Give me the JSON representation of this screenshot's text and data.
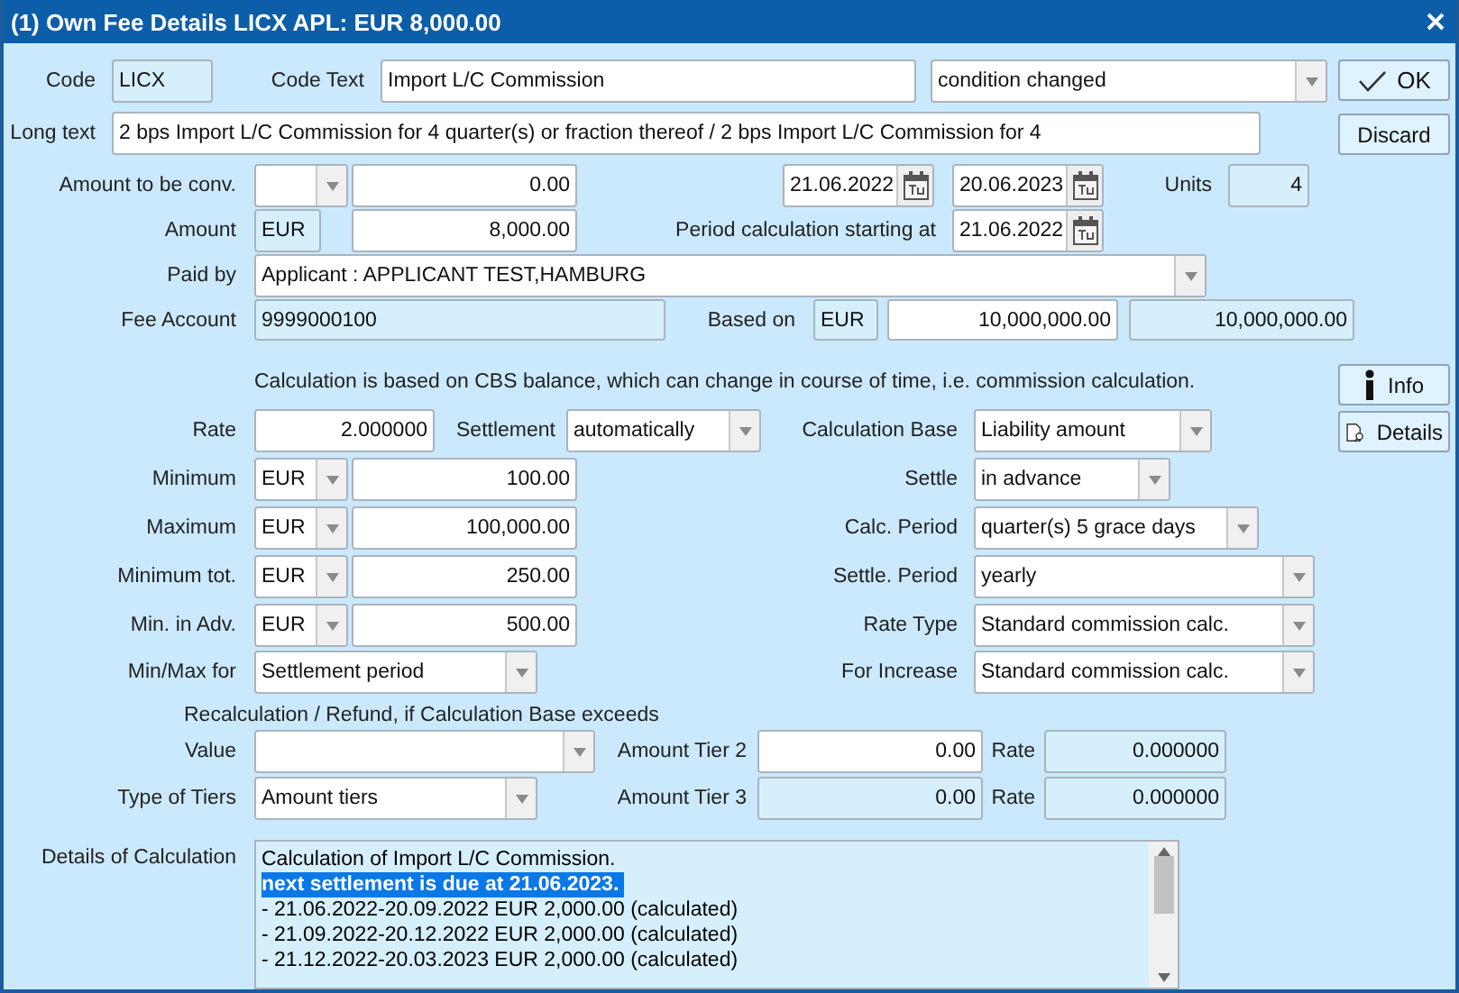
{
  "window": {
    "title": "(1) Own Fee Details LICX APL: EUR 8,000.00"
  },
  "rows": [
    {
      "fields": [
        {
          "kind": "label",
          "text": "Code"
        },
        {
          "kind": "readonly",
          "value": "LICX"
        },
        {
          "kind": "label",
          "text": "Code Text"
        },
        {
          "kind": "text",
          "value": "Import L/C Commission"
        },
        {
          "kind": "combo",
          "value": "condition changed"
        }
      ]
    },
    {
      "fields": [
        {
          "kind": "label",
          "text": "Long text"
        },
        {
          "kind": "text",
          "value": "2 bps Import L/C Commission for 4 quarter(s) or fraction thereof / 2 bps Import L/C Commission for 4"
        }
      ]
    },
    {
      "fields": [
        {
          "kind": "label",
          "text": "Amount to be conv."
        },
        {
          "kind": "combo"
        },
        {
          "kind": "number",
          "value": "0.00"
        },
        {
          "kind": "date",
          "value": "21.06.2022"
        },
        {
          "kind": "date",
          "value": "20.06.2023"
        },
        {
          "kind": "label",
          "text": "Units"
        },
        {
          "kind": "readonly_number",
          "value": "4"
        }
      ]
    },
    {
      "fields": [
        {
          "kind": "label",
          "text": "Amount"
        },
        {
          "kind": "readonly",
          "value": "EUR"
        },
        {
          "kind": "number",
          "value": "8,000.00"
        },
        {
          "kind": "label",
          "text": "Period calculation starting at"
        },
        {
          "kind": "date",
          "value": "21.06.2022"
        }
      ]
    },
    {
      "fields": [
        {
          "kind": "label",
          "text": "Paid by"
        },
        {
          "kind": "combo",
          "value": "Applicant : APPLICANT TEST,HAMBURG"
        }
      ]
    },
    {
      "fields": [
        {
          "kind": "label",
          "text": "Fee Account"
        },
        {
          "kind": "readonly",
          "value": "9999000100"
        },
        {
          "kind": "label",
          "text": "Based on"
        },
        {
          "kind": "readonly",
          "value": "EUR"
        },
        {
          "kind": "number",
          "value": "10,000,000.00"
        },
        {
          "kind": "readonly_number",
          "value": "10,000,000.00"
        }
      ]
    },
    {
      "fields": [
        {
          "kind": "note",
          "text": "Calculation is based on CBS balance, which can change in course of time, i.e. commission calculation."
        }
      ]
    },
    {
      "fields": [
        {
          "kind": "label",
          "text": "Rate"
        },
        {
          "kind": "number",
          "value": "2.000000"
        },
        {
          "kind": "label",
          "text": "Settlement"
        },
        {
          "kind": "combo",
          "value": "automatically"
        },
        {
          "kind": "label",
          "text": "Calculation Base"
        },
        {
          "kind": "combo",
          "value": "Liability amount"
        }
      ]
    },
    {
      "fields": [
        {
          "kind": "label",
          "text": "Minimum"
        },
        {
          "kind": "combo",
          "value": "EUR"
        },
        {
          "kind": "number",
          "value": "100.00"
        },
        {
          "kind": "label",
          "text": "Settle"
        },
        {
          "kind": "combo",
          "value": "in advance"
        }
      ]
    },
    {
      "fields": [
        {
          "kind": "label",
          "text": "Maximum"
        },
        {
          "kind": "combo",
          "value": "EUR"
        },
        {
          "kind": "number",
          "value": "100,000.00"
        },
        {
          "kind": "label",
          "text": "Calc. Period"
        },
        {
          "kind": "combo",
          "value": "quarter(s) 5 grace days"
        }
      ]
    },
    {
      "fields": [
        {
          "kind": "label",
          "text": "Minimum tot."
        },
        {
          "kind": "combo",
          "value": "EUR"
        },
        {
          "kind": "number",
          "value": "250.00"
        },
        {
          "kind": "label",
          "text": "Settle. Period"
        },
        {
          "kind": "combo",
          "value": "yearly"
        }
      ]
    },
    {
      "fields": [
        {
          "kind": "label",
          "text": "Min. in Adv."
        },
        {
          "kind": "combo",
          "value": "EUR"
        },
        {
          "kind": "number",
          "value": "500.00"
        },
        {
          "kind": "label",
          "text": "Rate Type"
        },
        {
          "kind": "combo",
          "value": "Standard commission calc."
        }
      ]
    },
    {
      "fields": [
        {
          "kind": "label",
          "text": "Min/Max for"
        },
        {
          "kind": "combo",
          "value": "Settlement period"
        },
        {
          "kind": "label",
          "text": "For Increase"
        },
        {
          "kind": "combo",
          "value": "Standard commission calc."
        }
      ]
    },
    {
      "fields": [
        {
          "kind": "note",
          "text": "Recalculation / Refund, if Calculation Base exceeds"
        }
      ]
    },
    {
      "fields": [
        {
          "kind": "label",
          "text": "Value"
        },
        {
          "kind": "combo"
        },
        {
          "kind": "label",
          "text": "Amount Tier 2"
        },
        {
          "kind": "number",
          "value": "0.00"
        },
        {
          "kind": "label",
          "text": "Rate"
        },
        {
          "kind": "readonly_number",
          "value": "0.000000"
        }
      ]
    },
    {
      "fields": [
        {
          "kind": "label",
          "text": "Type of Tiers"
        },
        {
          "kind": "combo",
          "value": "Amount tiers"
        },
        {
          "kind": "label",
          "text": "Amount Tier 3"
        },
        {
          "kind": "readonly_number",
          "value": "0.00"
        },
        {
          "kind": "label",
          "text": "Rate"
        },
        {
          "kind": "readonly_number",
          "value": "0.000000"
        }
      ]
    }
  ],
  "buttons": [
    {
      "label": "OK"
    },
    {
      "label": "Discard"
    },
    {
      "label": "Info"
    },
    {
      "label": "Details"
    }
  ],
  "details": {
    "label": "Details of Calculation",
    "lines": [
      {
        "text": "Calculation of Import L/C Commission.",
        "selected": false
      },
      {
        "text": "next settlement is due at 21.06.2023.",
        "selected": true
      },
      {
        "text": "- 21.06.2022-20.09.2022 EUR 2,000.00 (calculated)",
        "selected": false
      },
      {
        "text": "- 21.09.2022-20.12.2022 EUR 2,000.00 (calculated)",
        "selected": false
      },
      {
        "text": "- 21.12.2022-20.03.2023 EUR 2,000.00 (calculated)",
        "selected": false
      }
    ]
  }
}
